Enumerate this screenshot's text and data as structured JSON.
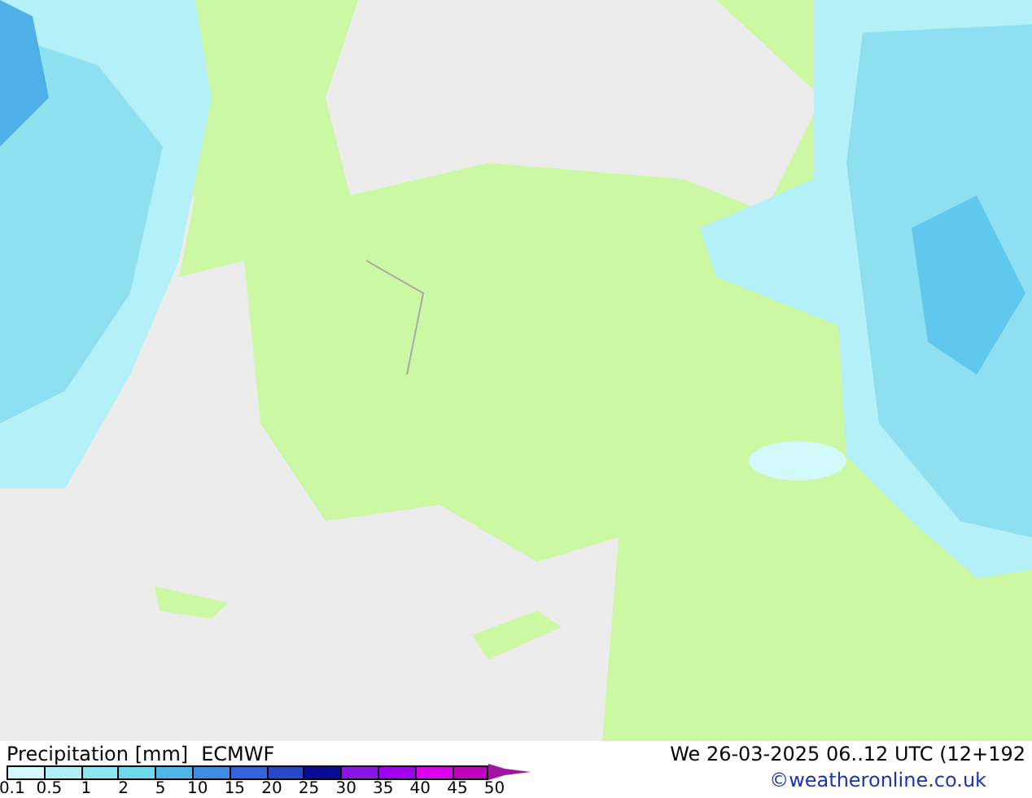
{
  "legend": {
    "title": "Precipitation [mm]",
    "model": "ECMWF",
    "segments": [
      {
        "color": "#d2fafa"
      },
      {
        "color": "#aef0f5"
      },
      {
        "color": "#8ce6f0"
      },
      {
        "color": "#6ed8eb"
      },
      {
        "color": "#50b4e6"
      },
      {
        "color": "#3c8ce1"
      },
      {
        "color": "#3264dc"
      },
      {
        "color": "#2846c8"
      },
      {
        "color": "#0a0a96"
      },
      {
        "color": "#8c14e6"
      },
      {
        "color": "#a000f0"
      },
      {
        "color": "#dc00f0"
      },
      {
        "color": "#be00be"
      },
      {
        "color": "#a014a0",
        "kind": "arrow"
      }
    ],
    "ticks": [
      "0.1",
      "0.5",
      "1",
      "2",
      "5",
      "10",
      "15",
      "20",
      "25",
      "30",
      "35",
      "40",
      "45",
      "50"
    ]
  },
  "valid_time": "We 26-03-2025 06..12 UTC (12+192",
  "credit": "©weatheronline.co.uk"
}
